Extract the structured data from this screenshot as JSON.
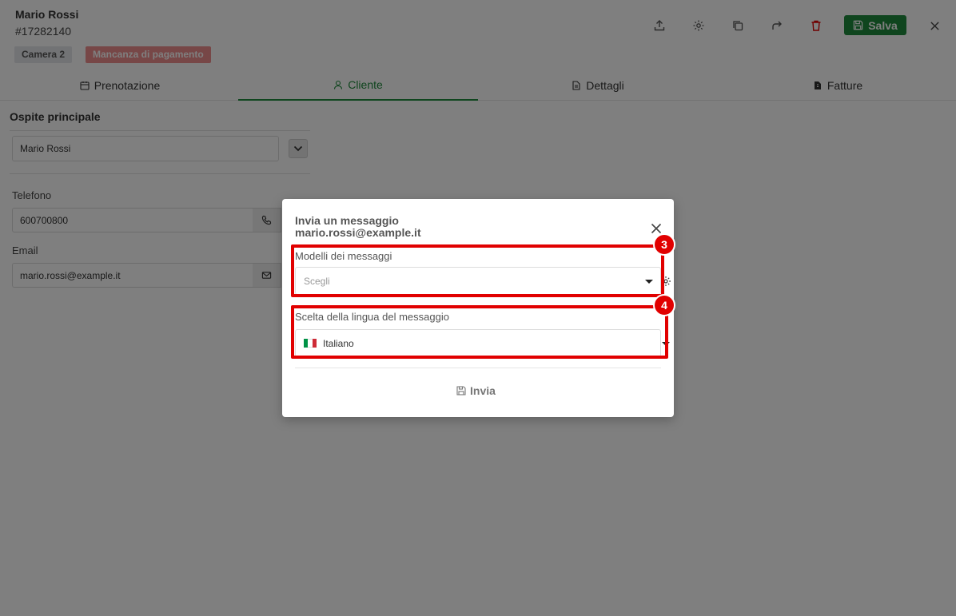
{
  "header": {
    "guest_name": "Mario Rossi",
    "booking_id": "#17282140",
    "tags": {
      "room": "Camera 2",
      "payment": "Mancanza di pagamento"
    },
    "save_label": "Salva"
  },
  "tabs": [
    {
      "label": "Prenotazione",
      "icon": "calendar-icon"
    },
    {
      "label": "Cliente",
      "icon": "user-icon",
      "active": true
    },
    {
      "label": "Dettagli",
      "icon": "document-icon"
    },
    {
      "label": "Fatture",
      "icon": "invoice-icon"
    }
  ],
  "client": {
    "section_title": "Ospite principale",
    "guest_select_value": "Mario Rossi",
    "phone_label": "Telefono",
    "phone_value": "600700800",
    "email_label": "Email",
    "email_value": "mario.rossi@example.it"
  },
  "modal": {
    "title_line1": "Invia un messaggio",
    "title_line2": "mario.rossi@example.it",
    "templates_label": "Modelli dei messaggi",
    "templates_placeholder": "Scegli",
    "language_label": "Scelta della lingua del messaggio",
    "language_value": "Italiano",
    "send_label": "Invia"
  },
  "annotations": [
    {
      "number": "3"
    },
    {
      "number": "4"
    }
  ],
  "colors": {
    "accent_green": "#1f8a3c",
    "danger_red": "#e10000",
    "tag_payment": "#ef8f8f"
  }
}
